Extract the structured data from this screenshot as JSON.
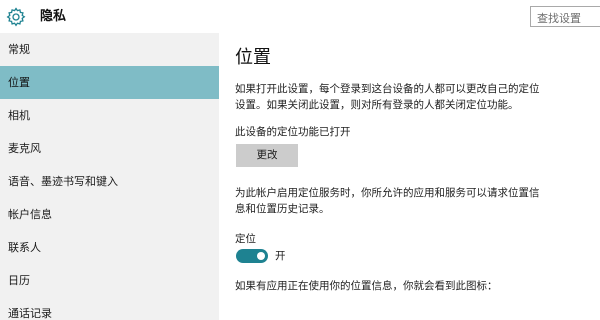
{
  "header": {
    "title": "隐私",
    "search_placeholder": "查找设置"
  },
  "sidebar": {
    "items": [
      {
        "label": "常规"
      },
      {
        "label": "位置"
      },
      {
        "label": "相机"
      },
      {
        "label": "麦克风"
      },
      {
        "label": "语音、墨迹书写和键入"
      },
      {
        "label": "帐户信息"
      },
      {
        "label": "联系人"
      },
      {
        "label": "日历"
      },
      {
        "label": "通话记录"
      }
    ],
    "selected": "位置"
  },
  "main": {
    "title": "位置",
    "description_line1": "如果打开此设置，每个登录到这台设备的人都可以更改自己的定位",
    "description_line2": "设置。如果关闭此设置，则对所有登录的人都关闭定位功能。",
    "device_status": "此设备的定位功能已打开",
    "change_button": "更改",
    "account_desc_line1": "为此帐户启用定位服务时，你所允许的应用和服务可以请求位置信",
    "account_desc_line2": "息和位置历史记录。",
    "location_label": "定位",
    "toggle_state": "开",
    "footer_text": "如果有应用正在使用你的位置信息，你就会看到此图标："
  },
  "colors": {
    "accent": "#1e8291",
    "selected_bg": "#7fbcc6",
    "sidebar_bg": "#f1f1f1",
    "button_bg": "#cccccc"
  },
  "icons": {
    "settings": "gear-icon"
  }
}
